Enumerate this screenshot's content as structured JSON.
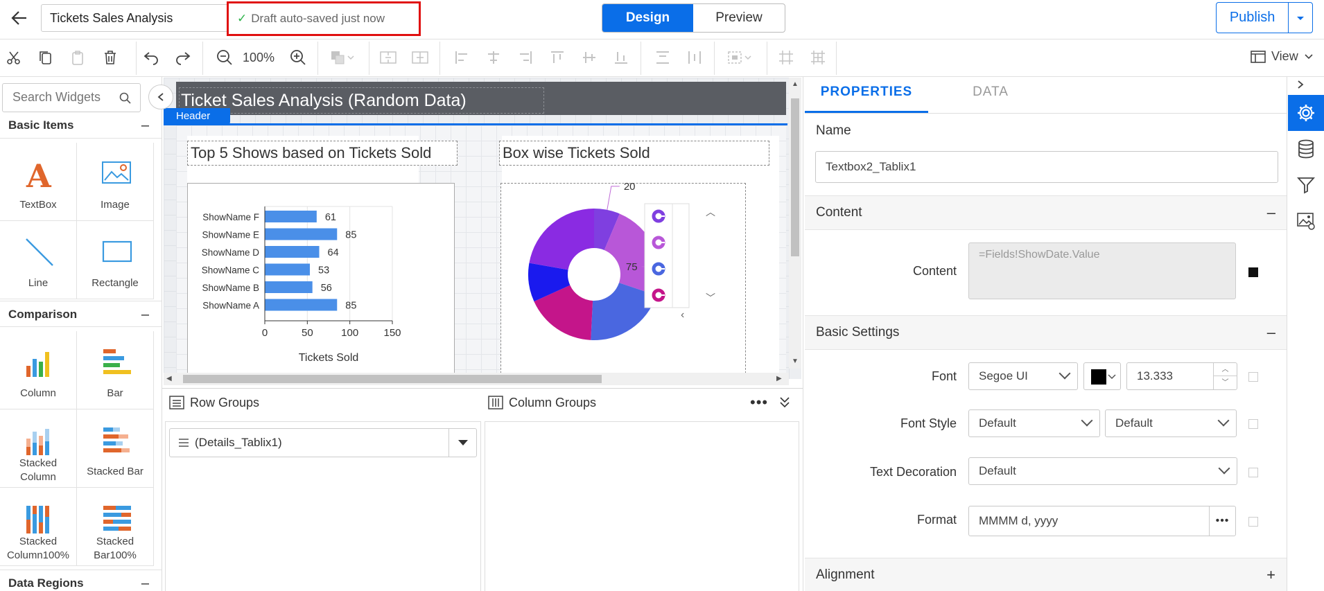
{
  "header": {
    "report_name": "Tickets Sales Analysis",
    "autosave_text": "Draft auto-saved just now",
    "mode_tabs": [
      "Design",
      "Preview"
    ],
    "publish_label": "Publish"
  },
  "toolbar": {
    "zoom": "100%",
    "view_label": "View"
  },
  "widgets": {
    "search_placeholder": "Search Widgets",
    "sections": [
      {
        "title": "Basic Items",
        "items": [
          "TextBox",
          "Image",
          "Line",
          "Rectangle"
        ]
      },
      {
        "title": "Comparison",
        "items": [
          "Column",
          "Bar",
          "Stacked Column",
          "Stacked Bar",
          "Stacked Column100%",
          "Stacked Bar100%"
        ]
      },
      {
        "title": "Data Regions"
      }
    ]
  },
  "canvas": {
    "report_title": "Ticket Sales Analysis (Random Data)",
    "header_tag": "Header",
    "bar_chart_title": "Top 5 Shows based on Tickets Sold",
    "donut_chart_title": "Box wise Tickets Sold"
  },
  "chart_data": [
    {
      "type": "bar",
      "title": "Top 5 Shows based on Tickets Sold",
      "categories": [
        "ShowName F",
        "ShowName E",
        "ShowName D",
        "ShowName C",
        "ShowName B",
        "ShowName A"
      ],
      "values": [
        61,
        85,
        64,
        53,
        56,
        85
      ],
      "xlabel": "Tickets Sold",
      "xlim": [
        0,
        150
      ],
      "xticks": [
        "0",
        "50",
        "100",
        "150"
      ],
      "color": "#4a8fe8",
      "grid": true
    },
    {
      "type": "pie",
      "title": "Box wise Tickets Sold",
      "donut": true,
      "values": [
        20,
        75,
        65,
        55,
        30,
        70
      ],
      "colors": [
        "#7f3fe0",
        "#b857d8",
        "#4a67e0",
        "#c4158a",
        "#1a1aee",
        "#8a2be2"
      ],
      "data_labels": [
        "20",
        "75"
      ]
    }
  ],
  "groups": {
    "row_groups_label": "Row Groups",
    "column_groups_label": "Column Groups",
    "row_group_item": "(Details_Tablix1)"
  },
  "properties": {
    "tabs": [
      "PROPERTIES",
      "DATA"
    ],
    "name_label": "Name",
    "name_value": "Textbox2_Tablix1",
    "content_section": "Content",
    "content_label": "Content",
    "content_value": "=Fields!ShowDate.Value",
    "basic_section": "Basic Settings",
    "font_label": "Font",
    "font_value": "Segoe UI",
    "font_size": "13.333",
    "font_color": "#000000",
    "font_style_label": "Font Style",
    "font_style_value": "Default",
    "font_weight_value": "Default",
    "text_decoration_label": "Text Decoration",
    "text_decoration_value": "Default",
    "format_label": "Format",
    "format_value": "MMMM d, yyyy",
    "alignment_section": "Alignment"
  }
}
